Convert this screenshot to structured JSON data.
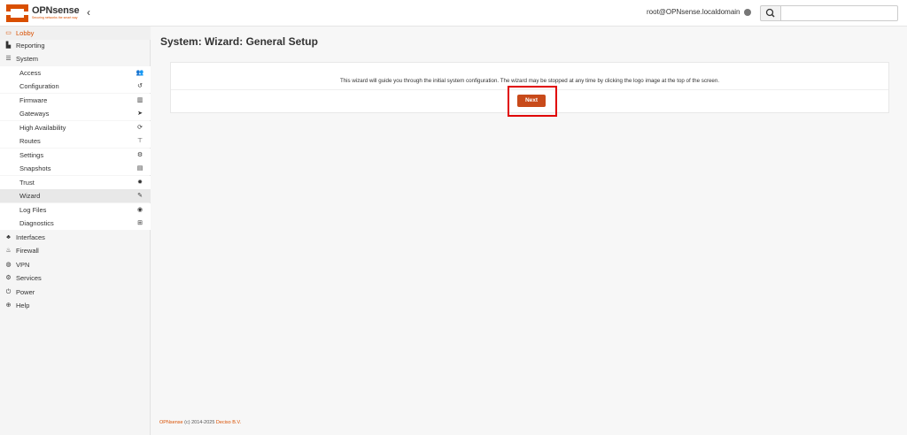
{
  "header": {
    "logo_text": "OPNsense",
    "logo_subtext": "Securing networks the smart way",
    "collapse_glyph": "‹",
    "user": "root@OPNsense.localdomain",
    "search_icon": "search-icon",
    "search_placeholder": ""
  },
  "sidebar": {
    "lobby": "Lobby",
    "reporting": "Reporting",
    "system": "System",
    "system_items": [
      {
        "label": "Access",
        "icon": "users-icon"
      },
      {
        "label": "Configuration",
        "icon": "history-icon"
      },
      {
        "label": "Firmware",
        "icon": "building-icon"
      },
      {
        "label": "Gateways",
        "icon": "location-arrow-icon"
      },
      {
        "label": "High Availability",
        "icon": "refresh-icon"
      },
      {
        "label": "Routes",
        "icon": "map-signs-icon"
      },
      {
        "label": "Settings",
        "icon": "cogs-icon"
      },
      {
        "label": "Snapshots",
        "icon": "server-icon"
      },
      {
        "label": "Trust",
        "icon": "certificate-icon"
      },
      {
        "label": "Wizard",
        "icon": "magic-icon"
      },
      {
        "label": "Log Files",
        "icon": "eye-icon"
      },
      {
        "label": "Diagnostics",
        "icon": "medkit-icon"
      }
    ],
    "interfaces": "Interfaces",
    "firewall": "Firewall",
    "vpn": "VPN",
    "services": "Services",
    "power": "Power",
    "help": "Help"
  },
  "main": {
    "title": "System: Wizard: General Setup",
    "intro": "This wizard will guide you through the initial system configuration. The wizard may be stopped at any time by clicking the logo image at the top of the screen.",
    "next_label": "Next"
  },
  "footer": {
    "brand": "OPNsense",
    "copyright": " (c) 2014-2025 ",
    "company": "Deciso B.V."
  },
  "colors": {
    "accent": "#d94f00",
    "button": "#c84a1a",
    "highlight": "#e00000"
  }
}
